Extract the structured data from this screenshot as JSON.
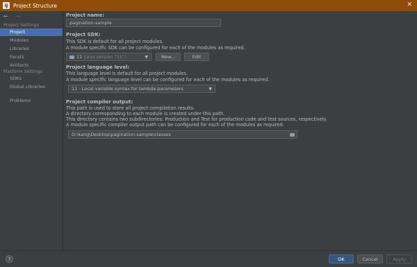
{
  "window": {
    "title": "Project Structure",
    "close_glyph": "✕",
    "app_icon": "intellij-icon"
  },
  "nav": {
    "back": "←",
    "forward": "→"
  },
  "sidebar": {
    "project_settings_header": "Project Settings",
    "project_settings_items": [
      "Project",
      "Modules",
      "Libraries",
      "Facets",
      "Artifacts"
    ],
    "platform_settings_header": "Platform Settings",
    "platform_settings_items": [
      "SDKs",
      "Global Libraries"
    ],
    "problems": "Problems",
    "selected": "Project",
    "selected_color": "#4b6eaf"
  },
  "project_name": {
    "label": "Project name:",
    "value": "pagination-sample"
  },
  "project_sdk": {
    "label": "Project SDK:",
    "desc1": "This SDK is default for all project modules.",
    "desc2": "A module specific SDK can be configured for each of the modules as required.",
    "selected_version": "11",
    "selected_detail": "(java version \"11\")",
    "new_button": "New...",
    "edit_button": "Edit"
  },
  "language_level": {
    "label": "Project language level:",
    "desc1": "This language level is default for all project modules.",
    "desc2": "A module specific language level can be configured for each of the modules as required.",
    "selected": "11 - Local variable syntax for lambda parameters"
  },
  "compiler_output": {
    "label": "Project compiler output:",
    "desc1": "This path is used to store all project compilation results.",
    "desc2": "A directory corresponding to each module is created under this path.",
    "desc3": "This directory contains two subdirectories: Production and Test for production code and test sources, respectively.",
    "desc4": "A module specific compiler output path can be configured for each of the modules as required.",
    "path": "D:\\kang\\Desktop\\pagination-sample\\classes"
  },
  "footer": {
    "help": "?",
    "ok": "OK",
    "cancel": "Cancel",
    "apply": "Apply",
    "ok_color": "#365880"
  }
}
